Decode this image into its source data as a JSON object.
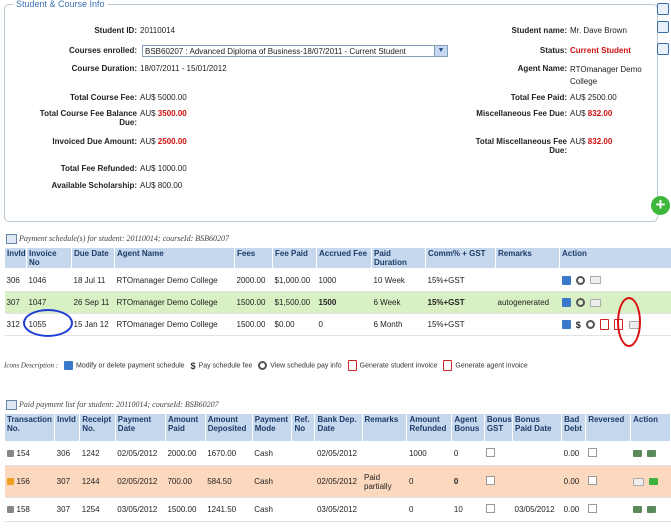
{
  "section_title": "Student & Course Info",
  "student": {
    "student_id_label": "Student ID:",
    "student_id": "20110014",
    "courses_label": "Courses enrolled:",
    "course_selected": "BSB60207 : Advanced Diploma of Business-18/07/2011 - Current Student",
    "duration_label": "Course Duration:",
    "duration": "18/07/2011 - 15/01/2012",
    "total_fee_label": "Total Course Fee:",
    "total_fee": "AU$ 5000.00",
    "balance_label_1": "Total Course Fee Balance",
    "balance_label_2": "Due:",
    "balance_prefix": "AU$",
    "balance_value": "3500.00",
    "invoiced_label": "Invoiced Due Amount:",
    "invoiced_prefix": "AU$",
    "invoiced_value": "2500.00",
    "refunded_label": "Total Fee Refunded:",
    "refunded": "AU$ 1000.00",
    "scholarship_label": "Available Scholarship:",
    "scholarship": "AU$ 800.00",
    "name_label": "Student name:",
    "name": "Mr. Dave Brown",
    "status_label": "Status:",
    "status": "Current Student",
    "agent_label": "Agent Name:",
    "agent_1": "RTOmanager Demo",
    "agent_2": "College",
    "fee_paid_label": "Total Fee Paid:",
    "fee_paid": "AU$ 2500.00",
    "misc_due_label": "Miscellaneous Fee Due:",
    "misc_due_prefix": "AU$",
    "misc_due_value": "832.00",
    "total_misc_label_1": "Total Miscellaneous Fee",
    "total_misc_label_2": "Due:",
    "total_misc_prefix": "AU$",
    "total_misc_value": "832.00"
  },
  "schedule": {
    "title": "Payment schedule(s) for student: 20110014; courseId: BSB60207",
    "headers": [
      "InvId",
      "Invoice No",
      "Due Date",
      "Agent Name",
      "Fees",
      "Fee Paid",
      "Accrued Fee",
      "Paid Duration",
      "Comm% + GST",
      "Remarks",
      "Action"
    ],
    "rows": [
      [
        "306",
        "1046",
        "18 Jul 11",
        "RTOmanager Demo College",
        "2000.00",
        "$1,000.00",
        "1000",
        "10 Week",
        "15%+GST",
        ""
      ],
      [
        "307",
        "1047",
        "26 Sep 11",
        "RTOmanager Demo College",
        "1500.00",
        "$1,500.00",
        "1500",
        "6 Week",
        "15%+GST",
        "autogenerated"
      ],
      [
        "312",
        "1055",
        "15 Jan 12",
        "RTOmanager Demo College",
        "1500.00",
        "$0.00",
        "0",
        "6 Month",
        "15%+GST",
        ""
      ]
    ]
  },
  "icon_legend": {
    "title": "Icons Description :",
    "modify": "Modify or delete payment schedule",
    "pay": "Pay schedule fee",
    "view": "View schedule pay info",
    "student_invoice": "Generate student invoice",
    "agent_invoice": "Generate agent invoice"
  },
  "paid": {
    "title": "Paid payment list for student: 20110014; courseId: BSB60207",
    "headers": [
      [
        "Transaction",
        "No."
      ],
      [
        "InvId",
        ""
      ],
      [
        "Receipt",
        "No."
      ],
      [
        "Payment",
        "Date"
      ],
      [
        "Amount",
        "Paid"
      ],
      [
        "Amount",
        "Deposited"
      ],
      [
        "Payment",
        "Mode"
      ],
      [
        "Ref.",
        "No"
      ],
      [
        "Bank Dep.",
        "Date"
      ],
      [
        "Remarks",
        ""
      ],
      [
        "Amount",
        "Refunded"
      ],
      [
        "Agent",
        "Bonus"
      ],
      [
        "Bonus",
        "GST"
      ],
      [
        "Bonus",
        "Paid Date"
      ],
      [
        "Bad",
        "Debt"
      ],
      [
        "Reversed",
        ""
      ],
      [
        "Action",
        ""
      ]
    ],
    "rows": [
      [
        "154",
        "306",
        "1242",
        "02/05/2012",
        "2000.00",
        "1670.00",
        "Cash",
        "",
        "02/05/2012",
        "",
        "1000",
        "0",
        "",
        "",
        "0.00"
      ],
      [
        "156",
        "307",
        "1244",
        "02/05/2012",
        "700.00",
        "584.50",
        "Cash",
        "",
        "02/05/2012",
        "Paid partially",
        "0",
        "0",
        "",
        "",
        "0.00"
      ],
      [
        "158",
        "307",
        "1254",
        "03/05/2012",
        "1500.00",
        "1241.50",
        "Cash",
        "",
        "03/05/2012",
        "",
        "0",
        "10",
        "",
        "03/05/2012",
        "0.00"
      ]
    ]
  }
}
